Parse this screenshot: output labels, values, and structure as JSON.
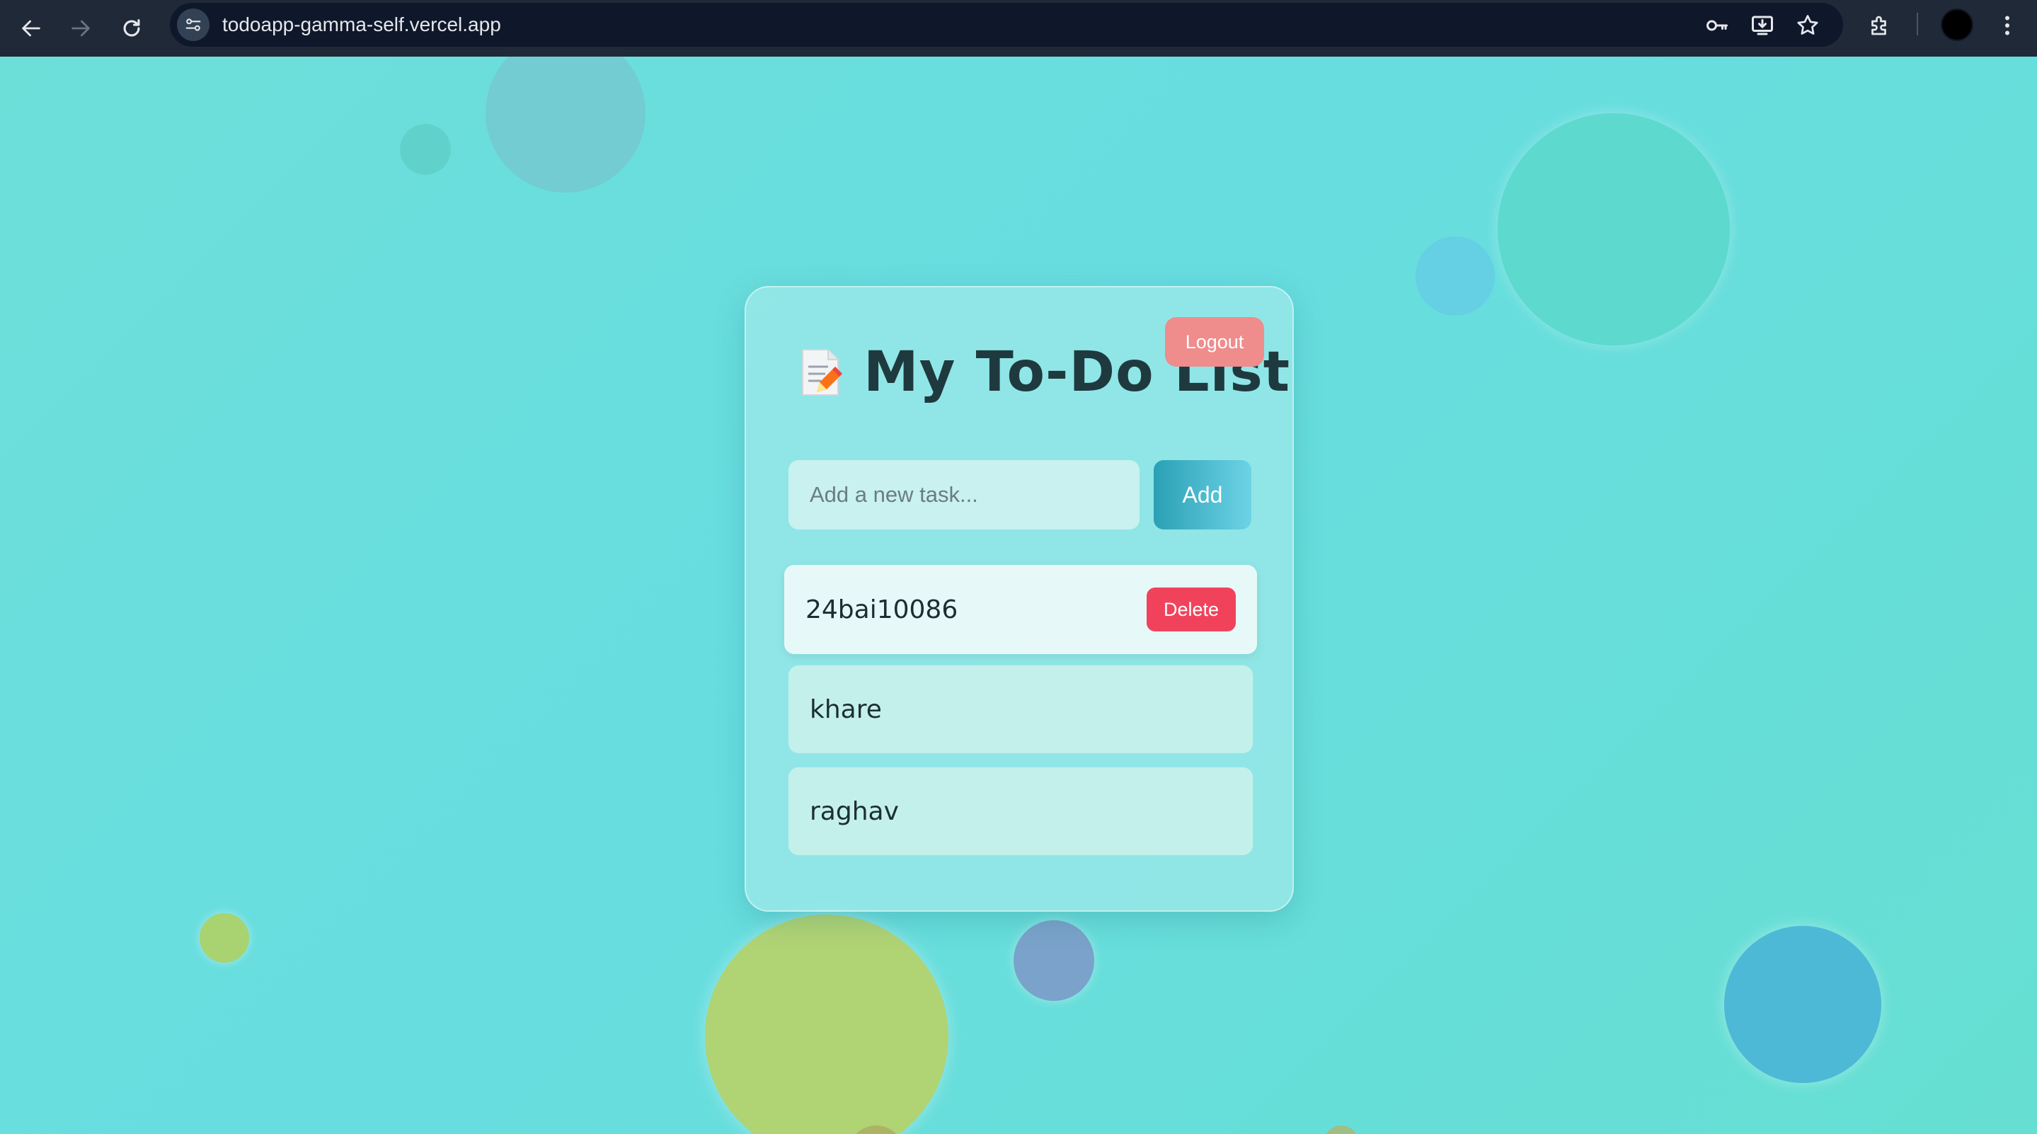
{
  "browser": {
    "url": "todoapp-gamma-self.vercel.app",
    "nav_icons": [
      "back-arrow-icon",
      "forward-arrow-icon",
      "reload-icon"
    ],
    "toolbar_icons": [
      "key-icon",
      "install-app-icon",
      "star-icon",
      "extensions-icon",
      "menu-icon"
    ]
  },
  "app": {
    "title_icon": "memo-icon",
    "title": "My To-Do List",
    "logout_label": "Logout",
    "input_placeholder": "Add a new task...",
    "input_value": "",
    "add_label": "Add",
    "delete_label": "Delete",
    "tasks": [
      {
        "text": "24bai10086",
        "hovered": true
      },
      {
        "text": "khare",
        "hovered": false
      },
      {
        "text": "raghav",
        "hovered": false
      }
    ]
  },
  "colors": {
    "page_background": "#66dcd9",
    "logout": "#ef8c8c",
    "delete": "#f0435b",
    "add_gradient_start": "#2ba0b5",
    "add_gradient_end": "#6dd3e6",
    "title": "#1f3a3f"
  }
}
